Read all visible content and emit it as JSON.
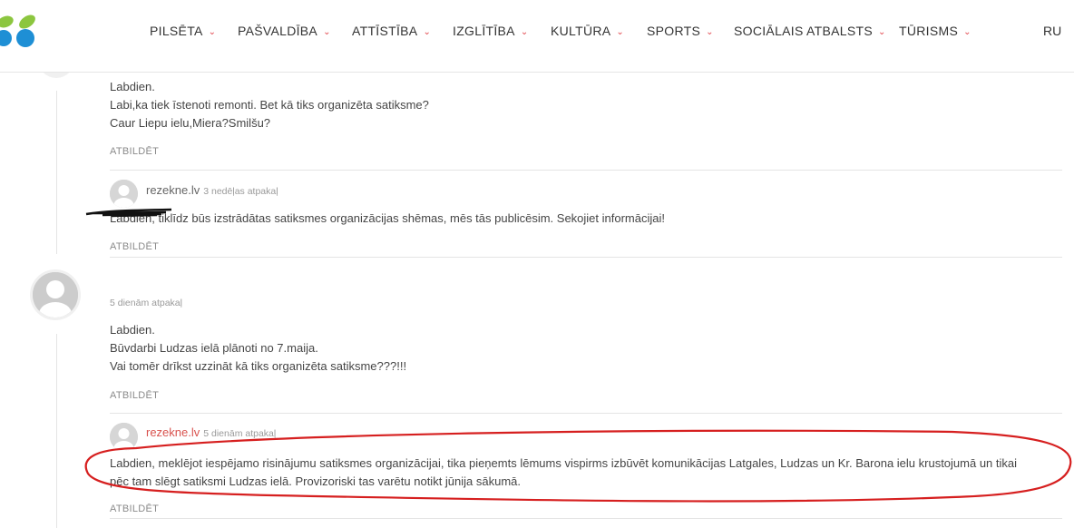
{
  "nav": {
    "items": [
      {
        "label": "PILSĒTA"
      },
      {
        "label": "PAŠVALDĪBA"
      },
      {
        "label": "ATTĪSTĪBA"
      },
      {
        "label": "IZGLĪTĪBA"
      },
      {
        "label": "KULTŪRA"
      },
      {
        "label": "SPORTS"
      },
      {
        "label": "SOCIĀLAIS ATBALSTS"
      },
      {
        "label": "TŪRISMS"
      }
    ],
    "lang": "RU",
    "chevron": "⌄"
  },
  "comments": {
    "c1": {
      "lines": [
        "Labdien.",
        "Labi,ka tiek īstenoti remonti. Bet kā tiks organizēta satiksme?",
        "Caur Liepu ielu,Miera?Smilšu?"
      ],
      "reply": "ATBILDĒT"
    },
    "r1": {
      "author": "rezekne.lv",
      "date": "3 nedēļas atpakaļ",
      "text": "Labdien, tiklīdz būs izstrādātas satiksmes organizācijas shēmas, mēs tās publicēsim. Sekojiet informācijai!",
      "reply": "ATBILDĒT"
    },
    "c2": {
      "date": "5 dienām atpakaļ",
      "lines": [
        "Labdien.",
        "Būvdarbi Ludzas ielā plānoti no 7.maija.",
        "Vai tomēr drīkst uzzināt kā tiks organizēta satiksme???!!!"
      ],
      "reply": "ATBILDĒT"
    },
    "r2": {
      "author": "rezekne.lv",
      "date": "5 dienām atpakaļ",
      "lines": [
        "Labdien, meklējot iespējamo risinājumu satiksmes organizācijai, tika pieņemts lēmums vispirms izbūvēt komunikācijas Latgales, Ludzas un Kr. Barona ielu krustojumā un tikai",
        "pēc tam slēgt satiksmi Ludzas ielā. Provizoriski tas varētu notikt jūnija sākumā."
      ],
      "reply": "ATBILDĒT"
    }
  },
  "colors": {
    "accent": "#e2474d",
    "annotation": "#d61f1f"
  }
}
